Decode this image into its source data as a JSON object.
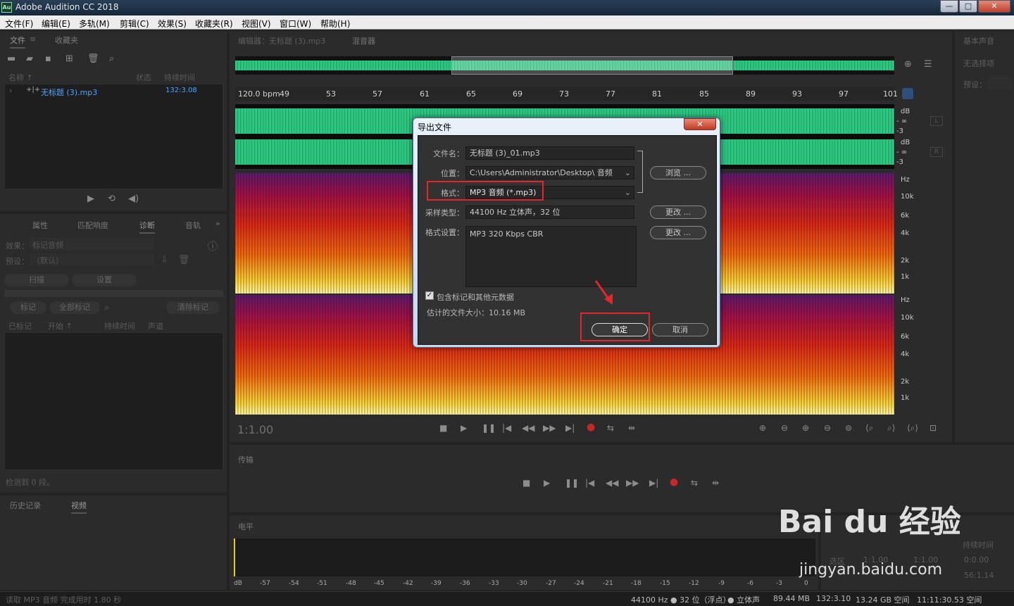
{
  "window": {
    "title": "Adobe Audition CC 2018",
    "logo": "Au",
    "buttons": [
      "—",
      "□",
      "✕"
    ]
  },
  "menu": [
    "文件(F)",
    "编辑(E)",
    "多轨(M)",
    "剪辑(C)",
    "效果(S)",
    "收藏夹(R)",
    "视图(V)",
    "窗口(W)",
    "帮助(H)"
  ],
  "files_panel": {
    "tabs": [
      "文件",
      "收藏夹"
    ],
    "columns": [
      "名称 ↑",
      "状态",
      "持续时间"
    ],
    "rows": [
      {
        "name": "无标题 (3).mp3",
        "duration": "132:3.08"
      }
    ]
  },
  "props_panel": {
    "tabs": [
      "属性",
      "匹配响度",
      "诊断",
      "音轨"
    ],
    "effect_label": "效果：",
    "effect_value": "标记音频",
    "preset_label": "预设：",
    "preset_value": "（默认）",
    "scan_btn": "扫描",
    "settings_btn": "设置",
    "mark_btn": "标记",
    "mark_all_btn": "全部标记",
    "clear_btn": "清除标记",
    "cols": [
      "已标记",
      "开始 ↑",
      "持续时间",
      "声道"
    ],
    "footer": "检测到 0 段。"
  },
  "history_panel": {
    "tabs": [
      "历史记录",
      "视频"
    ]
  },
  "editor": {
    "tab": "编辑器：无标题 (3).mp3",
    "mixer_tab": "混音器",
    "bpm": "120.0 bpm",
    "ruler": [
      "49",
      "53",
      "57",
      "61",
      "65",
      "69",
      "73",
      "77",
      "81",
      "85",
      "89",
      "93",
      "97",
      "101"
    ],
    "time": "1:1.00",
    "db_scale_top": [
      "dB",
      "- ∞",
      "-3"
    ],
    "db_scale_bot": [
      "dB",
      "- ∞",
      "-3"
    ],
    "freq_top": [
      "Hz",
      "10k",
      "6k",
      "4k",
      "2k",
      "1k"
    ],
    "freq_bot": [
      "Hz",
      "10k",
      "6k",
      "4k",
      "2k",
      "1k"
    ],
    "ch_l": "L",
    "ch_r": "R"
  },
  "right_panel": {
    "title": "基本声音",
    "no_sel": "无选择项",
    "preset": "预设："
  },
  "transport_panel": {
    "title": "传输"
  },
  "levels_panel": {
    "title": "电平",
    "scale": [
      "dB",
      "-57",
      "-54",
      "-51",
      "-48",
      "-45",
      "-42",
      "-39",
      "-36",
      "-33",
      "-30",
      "-27",
      "-24",
      "-21",
      "-18",
      "-15",
      "-12",
      "-9",
      "-6",
      "-3",
      "0"
    ]
  },
  "selection_panel": {
    "duration_label": "持续时间",
    "row1": [
      "选区",
      "1:1.00",
      "1:1.00",
      "0:0.00"
    ],
    "row2": "56:1.14"
  },
  "dialog": {
    "title": "导出文件",
    "filename_label": "文件名：",
    "filename": "无标题 (3)_01.mp3",
    "location_label": "位置：",
    "location": "C:\\Users\\Administrator\\Desktop\\ 音频",
    "browse_btn": "浏览 ...",
    "format_label": "格式：",
    "format": "MP3 音频 (*.mp3)",
    "sample_label": "采样类型：",
    "sample": "44100 Hz 立体声，32 位",
    "change_btn": "更改 ...",
    "settings_label": "格式设置：",
    "settings": "MP3 320 Kbps CBR",
    "change_btn2": "更改 ...",
    "include_markers": "包含标记和其他元数据",
    "est_size": "估计的文件大小：10.16 MB",
    "ok_btn": "确定",
    "cancel_btn": "取消"
  },
  "status": {
    "left": "读取 MP3 音频 完成用时 1.80 秒",
    "items": [
      "44100 Hz ● 32 位（浮点）",
      "● 立体声",
      "89.44 MB",
      "132:3.10",
      "13.24 GB 空间",
      "11:11:30.53 空间"
    ]
  },
  "watermark": {
    "logo": "Bai du 经验",
    "url": "jingyan.baidu.com"
  },
  "colors": {
    "wave": "#3fcf8e",
    "highlight": "#e3262b",
    "accent": "#4ea3ff"
  }
}
